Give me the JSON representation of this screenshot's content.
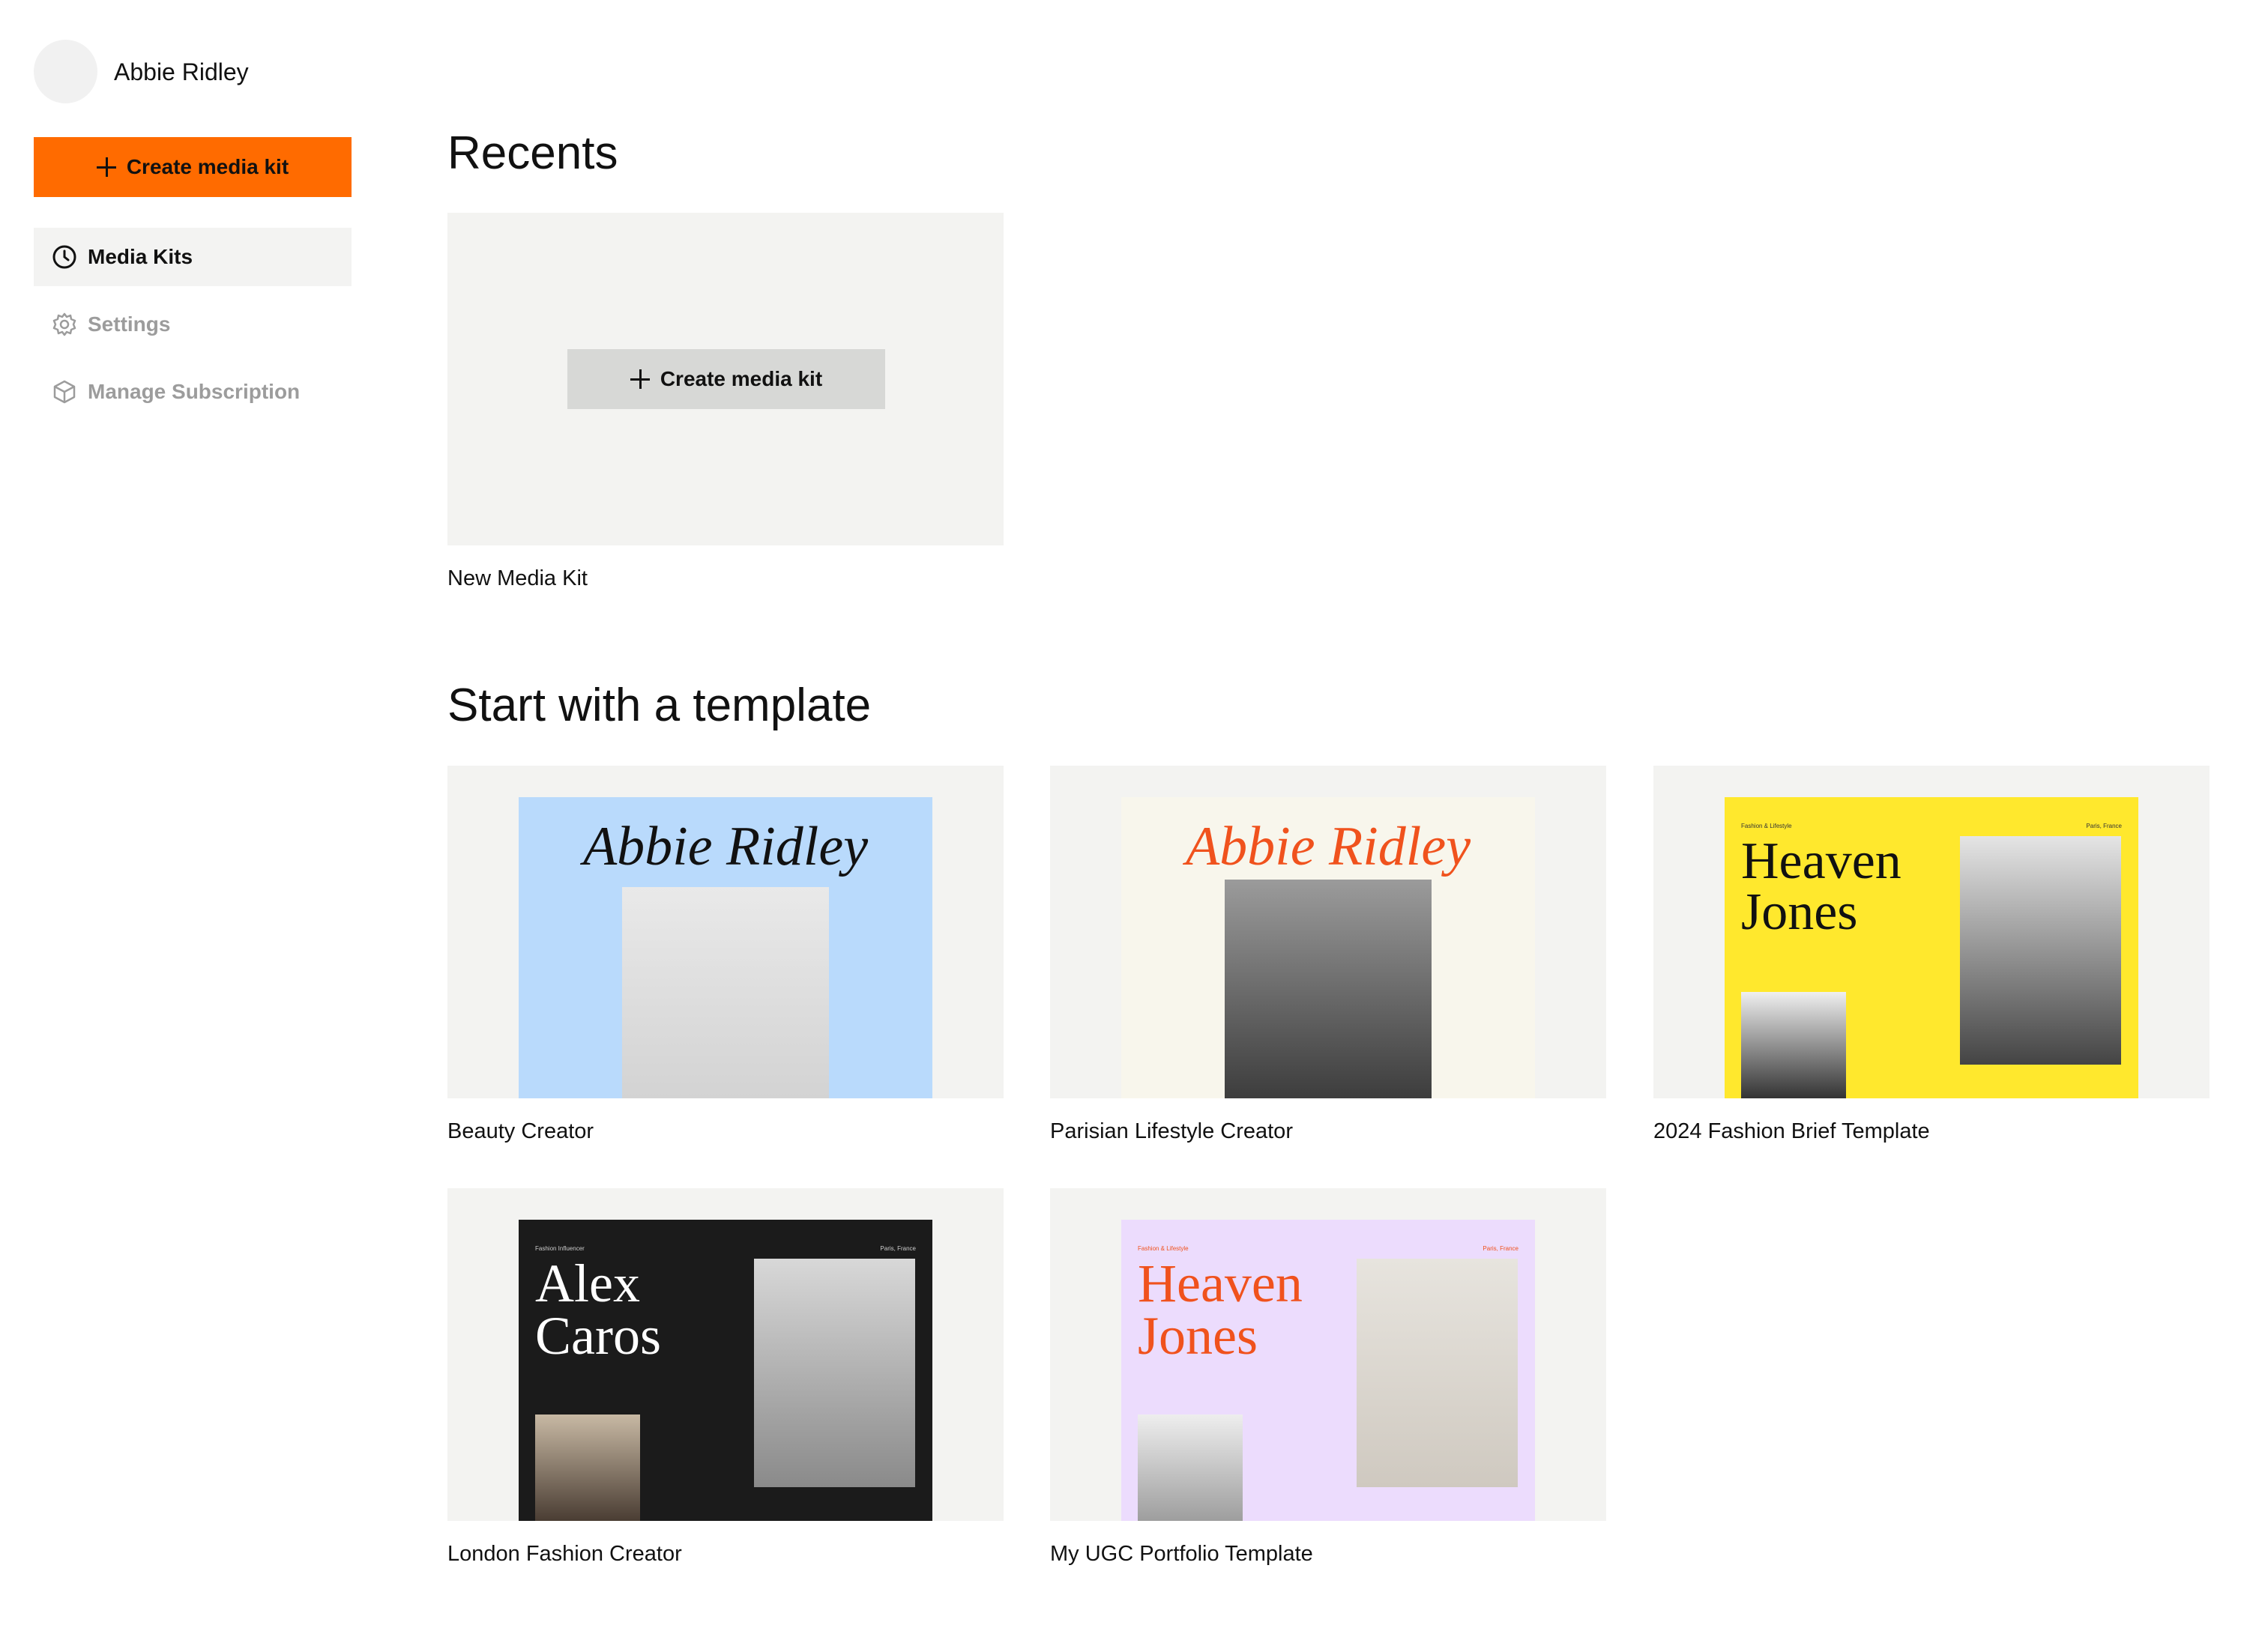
{
  "user": {
    "name": "Abbie Ridley"
  },
  "sidebar": {
    "create_label": "Create media kit",
    "nav": [
      {
        "label": "Media Kits",
        "icon": "clock-icon",
        "active": true
      },
      {
        "label": "Settings",
        "icon": "gear-icon",
        "active": false
      },
      {
        "label": "Manage Subscription",
        "icon": "box-icon",
        "active": false
      }
    ]
  },
  "recents": {
    "heading": "Recents",
    "create_label": "Create media kit",
    "items": [
      {
        "label": "New Media Kit"
      }
    ]
  },
  "templates": {
    "heading": "Start with a template",
    "items": [
      {
        "label": "Beauty Creator",
        "thumb_title": "Abbie Ridley"
      },
      {
        "label": "Parisian Lifestyle Creator",
        "thumb_title": "Abbie Ridley"
      },
      {
        "label": "2024 Fashion Brief Template",
        "thumb_title": "Heaven Jones",
        "tag_left": "Fashion & Lifestyle",
        "tag_right": "Paris, France"
      },
      {
        "label": "London Fashion Creator",
        "thumb_title": "Alex Caros",
        "tag_left": "Fashion Influencer",
        "tag_right": "Paris, France"
      },
      {
        "label": "My UGC Portfolio Template",
        "thumb_title": "Heaven Jones",
        "tag_left": "Fashion & Lifestyle",
        "tag_right": "Paris, France"
      }
    ]
  },
  "colors": {
    "accent": "#ff6b00",
    "card_bg": "#f3f3f1",
    "muted": "#9c9c9c"
  }
}
